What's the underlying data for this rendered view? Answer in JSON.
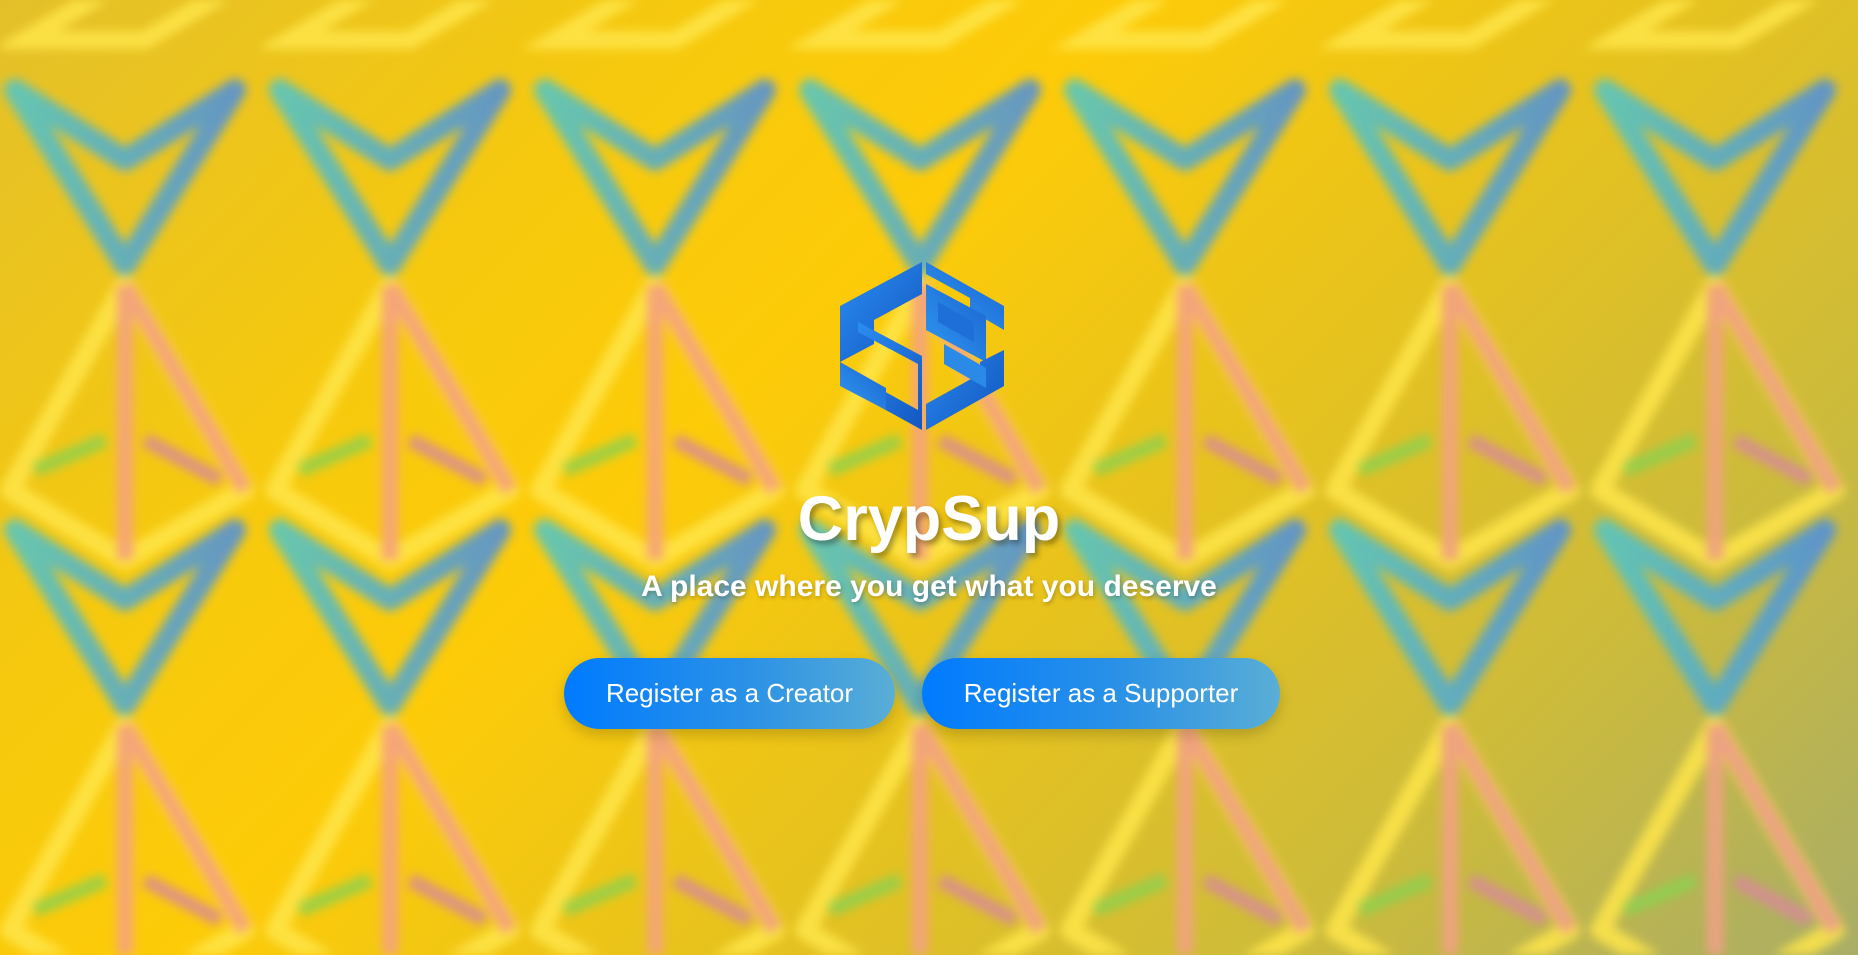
{
  "app": {
    "title": "CrypSup",
    "tagline": "A place where you get what you deserve",
    "logo_icon": "crypsup-hexagon-logo-icon"
  },
  "actions": {
    "creator_label": "Register as a Creator",
    "supporter_label": "Register as a Supporter"
  },
  "background": {
    "pattern_icon": "tron-triangle-pattern",
    "base_color": "#fdcb08"
  },
  "colors": {
    "button_start": "#007bff",
    "button_end": "#5aaed6",
    "logo_blue": "#1a73d9",
    "text": "#ffffff"
  }
}
